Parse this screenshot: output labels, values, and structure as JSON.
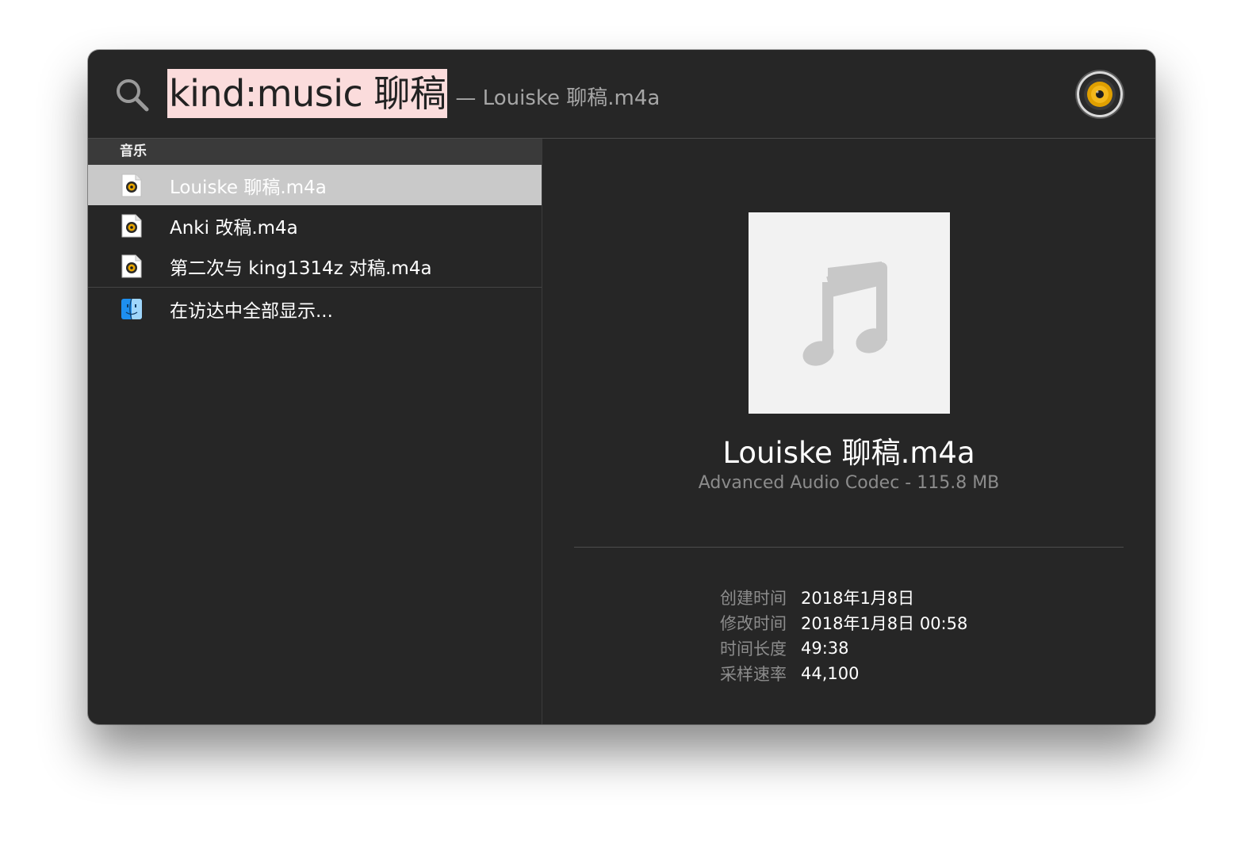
{
  "search": {
    "query": "kind:music 聊稿",
    "completion": "— Louiske 聊稿.m4a",
    "app_icon": "speaker-icon"
  },
  "results": {
    "section_title": "音乐",
    "items": [
      {
        "label": "Louiske 聊稿.m4a",
        "icon": "audio-file-icon",
        "selected": true
      },
      {
        "label": "Anki 改稿.m4a",
        "icon": "audio-file-icon",
        "selected": false
      },
      {
        "label": "第二次与 king1314z 对稿.m4a",
        "icon": "audio-file-icon",
        "selected": false
      }
    ],
    "show_all": {
      "label": "在访达中全部显示...",
      "icon": "finder-icon"
    }
  },
  "preview": {
    "art_icon": "music-note-icon",
    "title": "Louiske 聊稿.m4a",
    "subtitle": "Advanced Audio Codec - 115.8 MB",
    "metadata": [
      {
        "key": "创建时间",
        "value": "2018年1月8日"
      },
      {
        "key": "修改时间",
        "value": "2018年1月8日 00:58"
      },
      {
        "key": "时间长度",
        "value": "49:38"
      },
      {
        "key": "采样速率",
        "value": "44,100"
      }
    ]
  },
  "colors": {
    "window_bg": "#262626",
    "selection_bg": "#c9c9c9",
    "query_highlight": "#fbdcdc",
    "secondary_text": "#8c8c8c"
  }
}
